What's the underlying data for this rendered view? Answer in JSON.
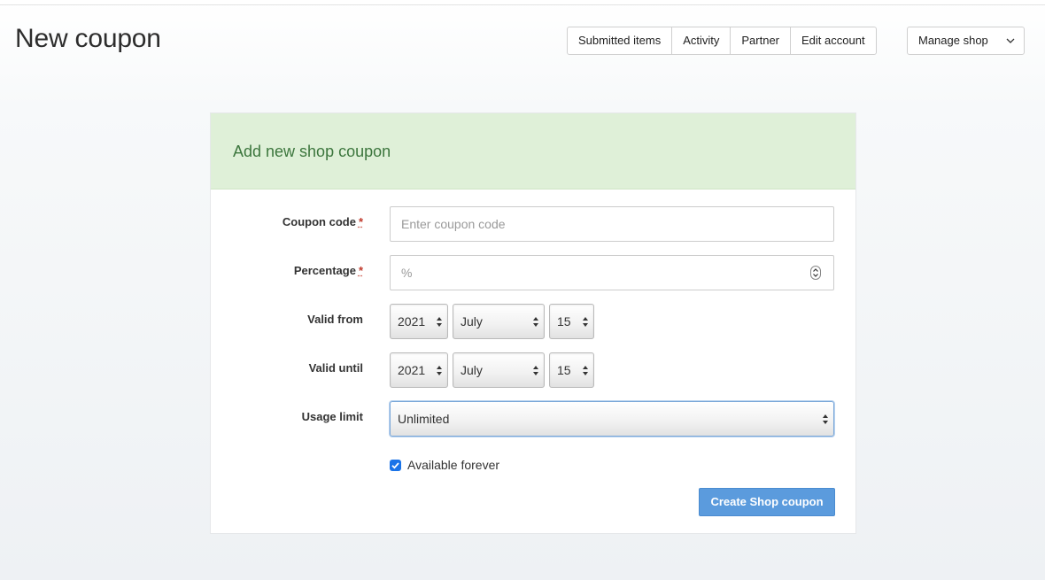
{
  "page": {
    "title": "New coupon"
  },
  "nav": {
    "items": [
      {
        "label": "Submitted items"
      },
      {
        "label": "Activity"
      },
      {
        "label": "Partner"
      },
      {
        "label": "Edit account"
      }
    ],
    "manage_label": "Manage shop",
    "manage_icon": "chevron-down-icon"
  },
  "card": {
    "title": "Add new shop coupon",
    "header_color": "#dff0d8",
    "title_color": "#3c763d"
  },
  "form": {
    "coupon_code": {
      "label": "Coupon code",
      "required_mark": "*",
      "value": "",
      "placeholder": "Enter coupon code"
    },
    "percentage": {
      "label": "Percentage",
      "required_mark": "*",
      "value": "",
      "placeholder": "%"
    },
    "valid_from": {
      "label": "Valid from",
      "year": "2021",
      "month": "July",
      "day": "15"
    },
    "valid_until": {
      "label": "Valid until",
      "year": "2021",
      "month": "July",
      "day": "15"
    },
    "usage_limit": {
      "label": "Usage limit",
      "selected": "Unlimited"
    },
    "available_forever": {
      "label": "Available forever",
      "checked": true
    },
    "submit_label": "Create Shop coupon",
    "submit_color": "#5b9bdd"
  }
}
